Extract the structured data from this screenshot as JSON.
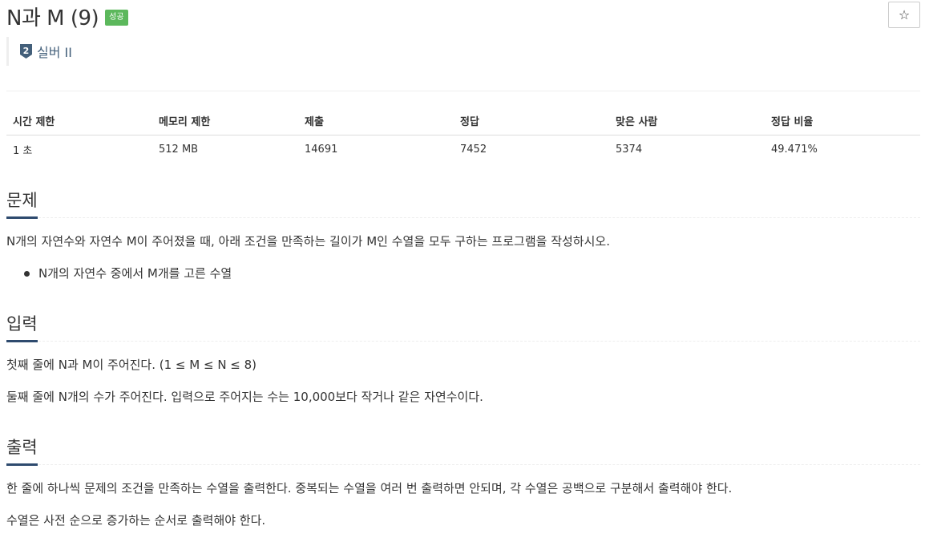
{
  "problem": {
    "title": "N과 M (9)",
    "status_badge": "성공",
    "star_icon": "☆",
    "tier": {
      "label": "실버 II",
      "level": "2",
      "color": "#435f7a"
    }
  },
  "info_table": {
    "headers": [
      "시간 제한",
      "메모리 제한",
      "제출",
      "정답",
      "맞은 사람",
      "정답 비율"
    ],
    "values": [
      "1 초",
      "512 MB",
      "14691",
      "7452",
      "5374",
      "49.471%"
    ]
  },
  "sections": {
    "problem": {
      "title": "문제",
      "paragraphs": [
        "N개의 자연수와 자연수 M이 주어졌을 때, 아래 조건을 만족하는 길이가 M인 수열을 모두 구하는 프로그램을 작성하시오."
      ],
      "bullets": [
        "N개의 자연수 중에서 M개를 고른 수열"
      ]
    },
    "input": {
      "title": "입력",
      "paragraphs": [
        "첫째 줄에 N과 M이 주어진다. (1 ≤ M ≤ N ≤ 8)",
        "둘째 줄에 N개의 수가 주어진다. 입력으로 주어지는 수는 10,000보다 작거나 같은 자연수이다."
      ]
    },
    "output": {
      "title": "출력",
      "paragraphs": [
        "한 줄에 하나씩 문제의 조건을 만족하는 수열을 출력한다. 중복되는 수열을 여러 번 출력하면 안되며, 각 수열은 공백으로 구분해서 출력해야 한다.",
        "수열은 사전 순으로 증가하는 순서로 출력해야 한다."
      ]
    }
  },
  "colors": {
    "success": "#5cb85c",
    "accent": "#2e4a6e"
  }
}
